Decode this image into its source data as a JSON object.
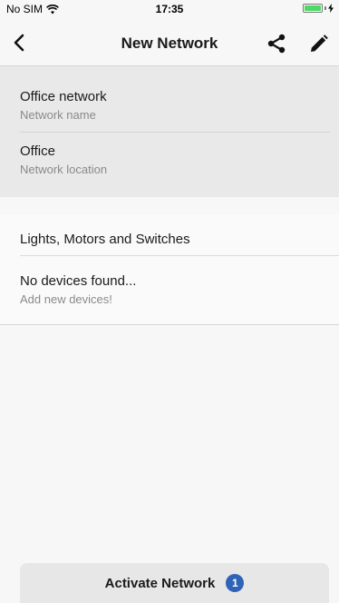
{
  "status_bar": {
    "carrier": "No SIM",
    "time": "17:35",
    "wifi_icon": "wifi-icon",
    "battery_icon": "battery-icon",
    "battery_color": "#4cd964"
  },
  "nav": {
    "title": "New Network",
    "back_icon": "chevron-left-icon",
    "share_icon": "share-icon",
    "edit_icon": "pencil-icon"
  },
  "network": {
    "name_value": "Office network",
    "name_label": "Network name",
    "location_value": "Office",
    "location_label": "Network location"
  },
  "devices": {
    "section_title": "Lights, Motors and Switches",
    "empty_title": "No devices found...",
    "empty_subtitle": "Add new devices!"
  },
  "footer": {
    "activate_label": "Activate Network",
    "badge_count": "1",
    "badge_color": "#2e63b8"
  }
}
